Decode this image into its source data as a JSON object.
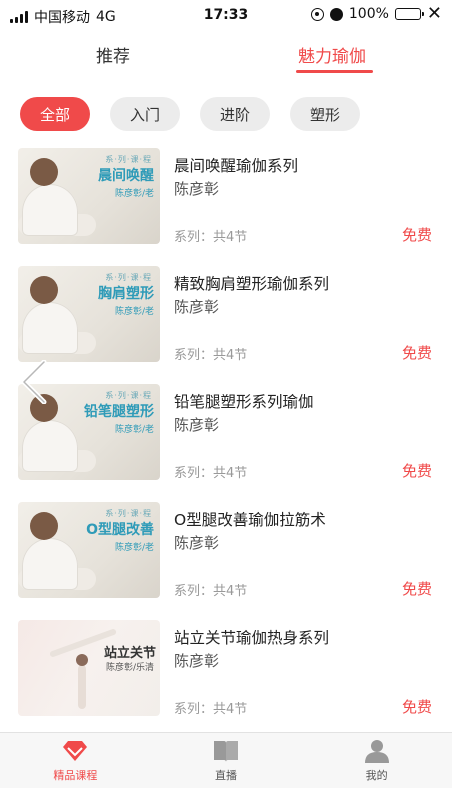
{
  "status_bar": {
    "carrier": "中国移动",
    "network": "4G",
    "time": "17:33",
    "battery_text": "100%",
    "battery_level": 1.0
  },
  "top_tabs": [
    {
      "label": "推荐",
      "active": false
    },
    {
      "label": "魅力瑜伽",
      "active": true
    }
  ],
  "filters": [
    {
      "label": "全部",
      "active": true
    },
    {
      "label": "入门",
      "active": false
    },
    {
      "label": "进阶",
      "active": false
    },
    {
      "label": "塑形",
      "active": false
    }
  ],
  "courses": [
    {
      "title": "晨间唤醒瑜伽系列",
      "author": "陈彦彰",
      "lessons": "系列：共4节",
      "price": "免费",
      "thumb_tag": "系·列·课·程",
      "thumb_title": "晨间唤醒",
      "thumb_sub": "陈彦彰/老",
      "thumb_style": "seated"
    },
    {
      "title": "精致胸肩塑形瑜伽系列",
      "author": "陈彦彰",
      "lessons": "系列：共4节",
      "price": "免费",
      "thumb_tag": "系·列·课·程",
      "thumb_title": "胸肩塑形",
      "thumb_sub": "陈彦彰/老",
      "thumb_style": "seated"
    },
    {
      "title": "铅笔腿塑形系列瑜伽",
      "author": "陈彦彰",
      "lessons": "系列：共4节",
      "price": "免费",
      "thumb_tag": "系·列·课·程",
      "thumb_title": "铅笔腿塑形",
      "thumb_sub": "陈彦彰/老",
      "thumb_style": "seated"
    },
    {
      "title": "O型腿改善瑜伽拉筋术",
      "author": "陈彦彰",
      "lessons": "系列：共4节",
      "price": "免费",
      "thumb_tag": "系·列·课·程",
      "thumb_title": "O型腿改善",
      "thumb_sub": "陈彦彰/老",
      "thumb_style": "seated"
    },
    {
      "title": "站立关节瑜伽热身系列",
      "author": "陈彦彰",
      "lessons": "系列：共4节",
      "price": "免费",
      "thumb_tag": "",
      "thumb_title": "站立关节",
      "thumb_sub": "陈彦彰/乐清",
      "thumb_style": "pose"
    }
  ],
  "bottom_nav": [
    {
      "label": "精品课程",
      "icon": "diamond-icon",
      "active": true
    },
    {
      "label": "直播",
      "icon": "book-icon",
      "active": false
    },
    {
      "label": "我的",
      "icon": "user-icon",
      "active": false
    }
  ],
  "colors": {
    "accent": "#f04a4a",
    "chip_bg": "#ececec",
    "thumb_text": "#2f9bb8"
  }
}
